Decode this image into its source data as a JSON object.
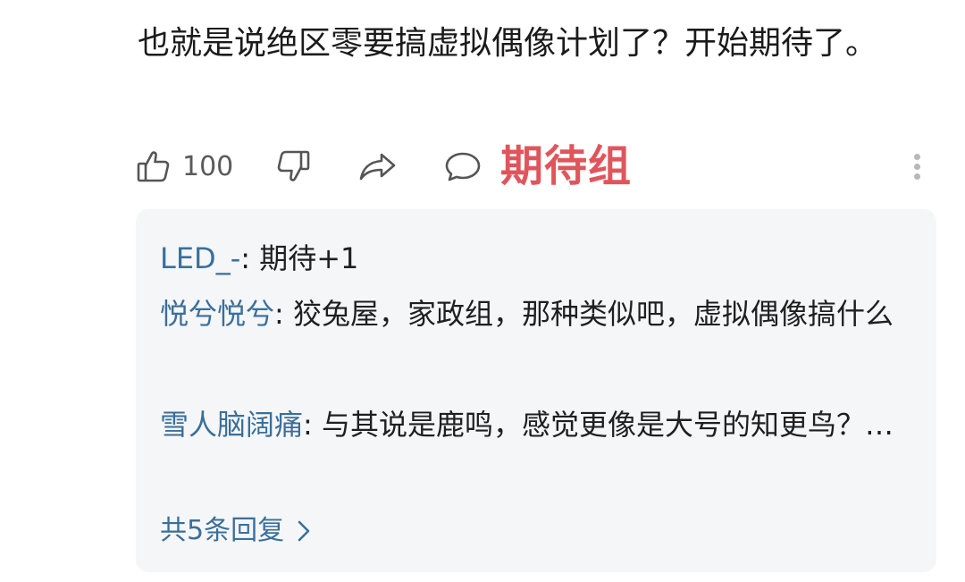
{
  "comment": {
    "text": "也就是说绝区零要搞虚拟偶像计划了？开始期待了。"
  },
  "actions": {
    "like_count": "100",
    "tag_label": "期待组",
    "icons": [
      "thumbs-up-icon",
      "thumbs-down-icon",
      "share-icon",
      "comment-icon",
      "more-vertical-icon"
    ]
  },
  "replies": {
    "items": [
      {
        "user": "LED_-",
        "separator": ": ",
        "text": "期待+1"
      },
      {
        "user": "悦兮悦兮",
        "separator": ": ",
        "text": "狡兔屋，家政组，那种类似吧，虚拟偶像搞什么"
      },
      {
        "user": "雪人脑阔痛",
        "separator": ": ",
        "text": "与其说是鹿鸣，感觉更像是大号的知更鸟？…"
      }
    ],
    "view_all_label": "共5条回复"
  },
  "colors": {
    "username": "#3a6f9a",
    "tag": "#e0555c",
    "reply_bg": "#f5f6f8",
    "icon": "#555555"
  }
}
